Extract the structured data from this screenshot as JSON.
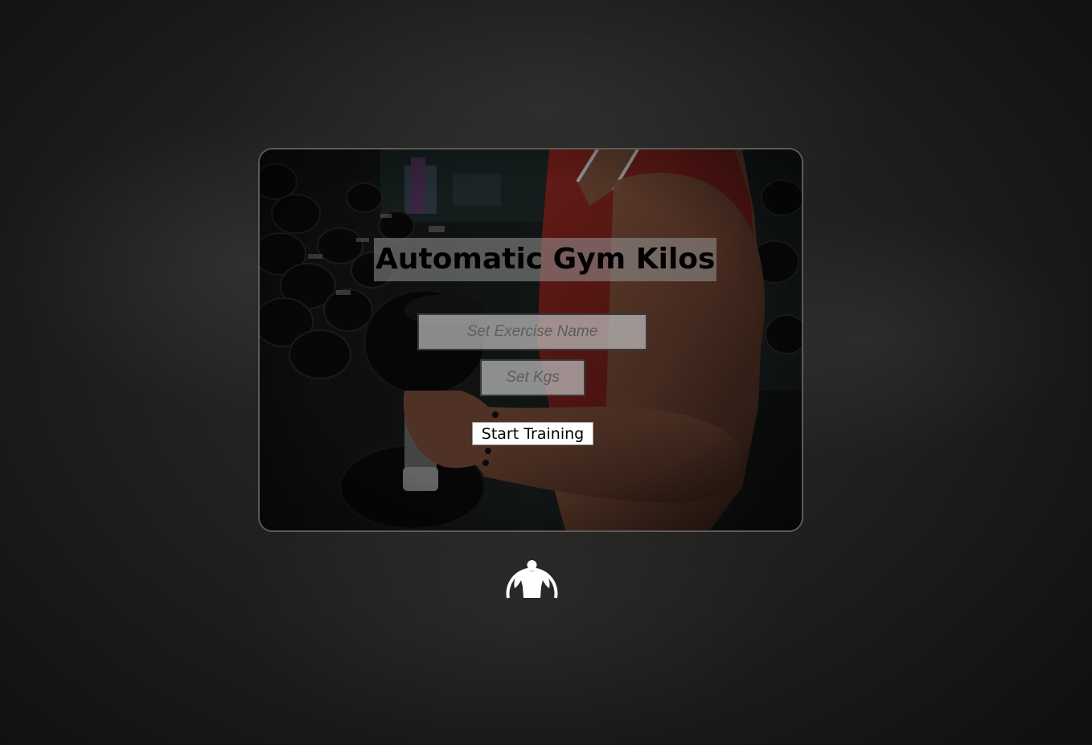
{
  "app": {
    "title": "Automatic Gym Kilos"
  },
  "form": {
    "exercise_placeholder": "Set Exercise Name",
    "kgs_placeholder": "Set Kgs",
    "start_label": "Start Training"
  },
  "icons": {
    "logo": "bodybuilder-logo-icon"
  },
  "colors": {
    "background": "#1d1d1c",
    "card_border": "#5a5a5a",
    "field_background": "#bebebe",
    "shirt_accent": "#b8302a"
  }
}
